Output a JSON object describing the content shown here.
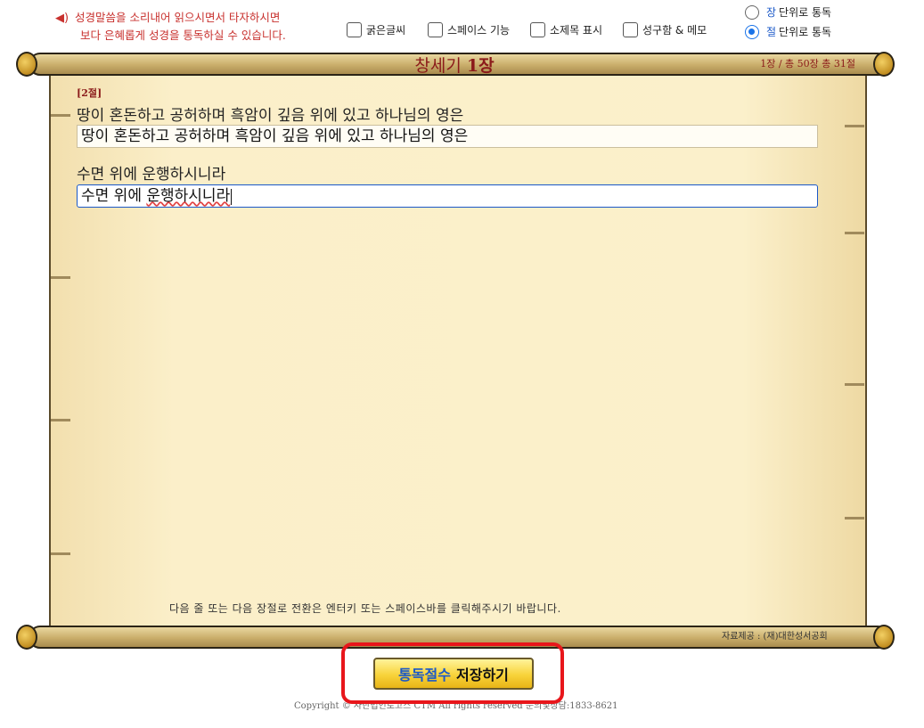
{
  "notice": {
    "line1": "성경말씀을 소리내어 읽으시면서 타자하시면",
    "line2": "보다 은혜롭게 성경을 통독하실 수 있습니다."
  },
  "options": [
    {
      "label": "굵은글씨",
      "checked": false
    },
    {
      "label": "스페이스 기능",
      "checked": false
    },
    {
      "label": "소제목 표시",
      "checked": false
    },
    {
      "label": "성구함 & 메모",
      "checked": false
    }
  ],
  "mode": {
    "chapter": {
      "key": "장",
      "rest": "단위로 통독",
      "selected": false
    },
    "verse": {
      "key": "절",
      "rest": "단위로 통독",
      "selected": true
    }
  },
  "scroll": {
    "title_book": "창세기 ",
    "title_chapter": "1장",
    "counter": "1장 / 총 50장   총 31절"
  },
  "verse": {
    "number": "[2절]",
    "line1_ref": "땅이 혼돈하고 공허하며 흑암이 깊음 위에 있고 하나님의 영은",
    "line1_typed": "땅이 혼돈하고 공허하며 흑암이 깊음 위에 있고 하나님의 영은",
    "line2_ref": "수면 위에 운행하시니라",
    "line2_typed_plain": "수면 위에 ",
    "line2_typed_marked": "운행하시니라"
  },
  "hint": "다음 줄 또는 다음 장절로 전환은 엔터키 또는 스페이스바를 클릭해주시기 바랍니다.",
  "source": "자료제공 : (재)대한성서공회",
  "save_button": {
    "highlight": "통독절수",
    "rest": "저장하기"
  },
  "copyright": "Copyright © 사단법인로고스 CTM All rights reserved 문의및상담:1833-8621",
  "colors": {
    "accent_red": "#e8161b",
    "title_red": "#8b1a1a",
    "link_blue": "#1a58c8",
    "button_yellow": "#f8d33a"
  }
}
